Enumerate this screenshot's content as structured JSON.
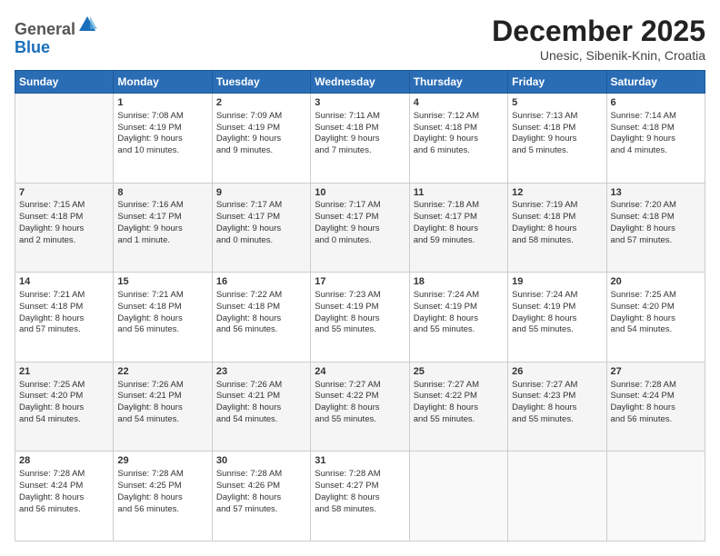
{
  "header": {
    "logo_general": "General",
    "logo_blue": "Blue",
    "month": "December 2025",
    "location": "Unesic, Sibenik-Knin, Croatia"
  },
  "days_of_week": [
    "Sunday",
    "Monday",
    "Tuesday",
    "Wednesday",
    "Thursday",
    "Friday",
    "Saturday"
  ],
  "weeks": [
    [
      {
        "day": "",
        "content": ""
      },
      {
        "day": "1",
        "content": "Sunrise: 7:08 AM\nSunset: 4:19 PM\nDaylight: 9 hours\nand 10 minutes."
      },
      {
        "day": "2",
        "content": "Sunrise: 7:09 AM\nSunset: 4:19 PM\nDaylight: 9 hours\nand 9 minutes."
      },
      {
        "day": "3",
        "content": "Sunrise: 7:11 AM\nSunset: 4:18 PM\nDaylight: 9 hours\nand 7 minutes."
      },
      {
        "day": "4",
        "content": "Sunrise: 7:12 AM\nSunset: 4:18 PM\nDaylight: 9 hours\nand 6 minutes."
      },
      {
        "day": "5",
        "content": "Sunrise: 7:13 AM\nSunset: 4:18 PM\nDaylight: 9 hours\nand 5 minutes."
      },
      {
        "day": "6",
        "content": "Sunrise: 7:14 AM\nSunset: 4:18 PM\nDaylight: 9 hours\nand 4 minutes."
      }
    ],
    [
      {
        "day": "7",
        "content": "Sunrise: 7:15 AM\nSunset: 4:18 PM\nDaylight: 9 hours\nand 2 minutes."
      },
      {
        "day": "8",
        "content": "Sunrise: 7:16 AM\nSunset: 4:17 PM\nDaylight: 9 hours\nand 1 minute."
      },
      {
        "day": "9",
        "content": "Sunrise: 7:17 AM\nSunset: 4:17 PM\nDaylight: 9 hours\nand 0 minutes."
      },
      {
        "day": "10",
        "content": "Sunrise: 7:17 AM\nSunset: 4:17 PM\nDaylight: 9 hours\nand 0 minutes."
      },
      {
        "day": "11",
        "content": "Sunrise: 7:18 AM\nSunset: 4:17 PM\nDaylight: 8 hours\nand 59 minutes."
      },
      {
        "day": "12",
        "content": "Sunrise: 7:19 AM\nSunset: 4:18 PM\nDaylight: 8 hours\nand 58 minutes."
      },
      {
        "day": "13",
        "content": "Sunrise: 7:20 AM\nSunset: 4:18 PM\nDaylight: 8 hours\nand 57 minutes."
      }
    ],
    [
      {
        "day": "14",
        "content": "Sunrise: 7:21 AM\nSunset: 4:18 PM\nDaylight: 8 hours\nand 57 minutes."
      },
      {
        "day": "15",
        "content": "Sunrise: 7:21 AM\nSunset: 4:18 PM\nDaylight: 8 hours\nand 56 minutes."
      },
      {
        "day": "16",
        "content": "Sunrise: 7:22 AM\nSunset: 4:18 PM\nDaylight: 8 hours\nand 56 minutes."
      },
      {
        "day": "17",
        "content": "Sunrise: 7:23 AM\nSunset: 4:19 PM\nDaylight: 8 hours\nand 55 minutes."
      },
      {
        "day": "18",
        "content": "Sunrise: 7:24 AM\nSunset: 4:19 PM\nDaylight: 8 hours\nand 55 minutes."
      },
      {
        "day": "19",
        "content": "Sunrise: 7:24 AM\nSunset: 4:19 PM\nDaylight: 8 hours\nand 55 minutes."
      },
      {
        "day": "20",
        "content": "Sunrise: 7:25 AM\nSunset: 4:20 PM\nDaylight: 8 hours\nand 54 minutes."
      }
    ],
    [
      {
        "day": "21",
        "content": "Sunrise: 7:25 AM\nSunset: 4:20 PM\nDaylight: 8 hours\nand 54 minutes."
      },
      {
        "day": "22",
        "content": "Sunrise: 7:26 AM\nSunset: 4:21 PM\nDaylight: 8 hours\nand 54 minutes."
      },
      {
        "day": "23",
        "content": "Sunrise: 7:26 AM\nSunset: 4:21 PM\nDaylight: 8 hours\nand 54 minutes."
      },
      {
        "day": "24",
        "content": "Sunrise: 7:27 AM\nSunset: 4:22 PM\nDaylight: 8 hours\nand 55 minutes."
      },
      {
        "day": "25",
        "content": "Sunrise: 7:27 AM\nSunset: 4:22 PM\nDaylight: 8 hours\nand 55 minutes."
      },
      {
        "day": "26",
        "content": "Sunrise: 7:27 AM\nSunset: 4:23 PM\nDaylight: 8 hours\nand 55 minutes."
      },
      {
        "day": "27",
        "content": "Sunrise: 7:28 AM\nSunset: 4:24 PM\nDaylight: 8 hours\nand 56 minutes."
      }
    ],
    [
      {
        "day": "28",
        "content": "Sunrise: 7:28 AM\nSunset: 4:24 PM\nDaylight: 8 hours\nand 56 minutes."
      },
      {
        "day": "29",
        "content": "Sunrise: 7:28 AM\nSunset: 4:25 PM\nDaylight: 8 hours\nand 56 minutes."
      },
      {
        "day": "30",
        "content": "Sunrise: 7:28 AM\nSunset: 4:26 PM\nDaylight: 8 hours\nand 57 minutes."
      },
      {
        "day": "31",
        "content": "Sunrise: 7:28 AM\nSunset: 4:27 PM\nDaylight: 8 hours\nand 58 minutes."
      },
      {
        "day": "",
        "content": ""
      },
      {
        "day": "",
        "content": ""
      },
      {
        "day": "",
        "content": ""
      }
    ]
  ]
}
